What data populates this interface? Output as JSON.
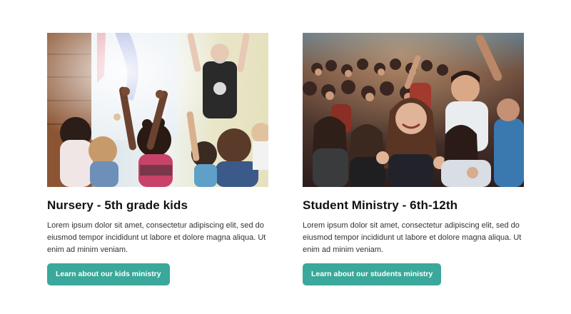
{
  "cards": [
    {
      "title": "Nursery - 5th grade kids",
      "body": "Lorem ipsum dolor sit amet, consectetur adipiscing elit, sed do eiusmod tempor incididunt ut labore et dolore magna aliqua. Ut enim ad minim veniam.",
      "button_label": "Learn about our kids ministry"
    },
    {
      "title": "Student Ministry - 6th-12th",
      "body": "Lorem ipsum dolor sit amet, consectetur adipiscing elit, sed do eiusmod tempor incididunt ut labore et dolore magna aliqua. Ut enim ad minim veniam.",
      "button_label": "Learn about our students ministry"
    }
  ],
  "colors": {
    "button_bg": "#3aa89a",
    "button_text": "#ffffff",
    "title": "#111111"
  }
}
